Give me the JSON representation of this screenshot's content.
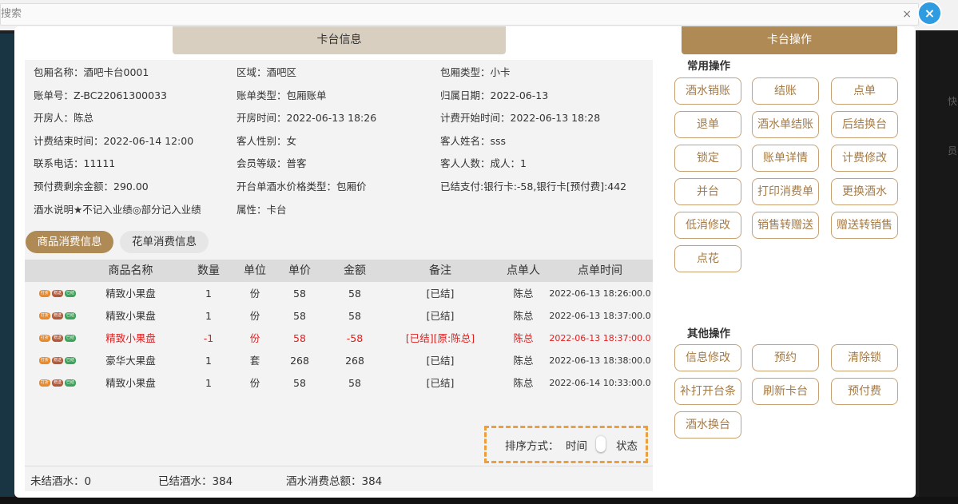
{
  "background": {
    "search_placeholder": "搜索",
    "search_clear": "×",
    "right_text_1": "快",
    "right_text_2": "员"
  },
  "close_label": "×",
  "left_panel": {
    "title": "卡台信息",
    "info": [
      [
        "包厢名称：酒吧卡台0001",
        "区域：酒吧区",
        "包厢类型：小卡"
      ],
      [
        "账单号：Z-BC22061300033",
        "账单类型：包厢账单",
        "归属日期：2022-06-13"
      ],
      [
        "开房人：陈总",
        "开房时间：2022-06-13 18:26",
        "计费开始时间：2022-06-13 18:28"
      ],
      [
        "计费结束时间：2022-06-14 12:00",
        "客人性别：女",
        "客人姓名：sss"
      ],
      [
        "联系电话：11111",
        "会员等级：普客",
        "客人人数：成人：1"
      ],
      [
        "预付费剩余金额：290.00",
        "开台单酒水价格类型：包厢价",
        "已结支付:银行卡:-58,银行卡[预付费]:442"
      ],
      [
        "酒水说明★不记入业绩◎部分记入业绩",
        "属性：卡台",
        ""
      ]
    ],
    "tabs": [
      "商品消费信息",
      "花单消费信息"
    ],
    "table": {
      "headers": [
        "商品名称",
        "数量",
        "单位",
        "单价",
        "金额",
        "备注",
        "点单人",
        "点单时间"
      ],
      "tag_labels": [
        "打折",
        "赠送",
        "已结"
      ],
      "rows": [
        {
          "name": "精致小果盘",
          "qty": "1",
          "unit": "份",
          "price": "58",
          "amount": "58",
          "note": "[已结]",
          "orderer": "陈总",
          "time": "2022-06-13 18:26:00.0",
          "red": false
        },
        {
          "name": "精致小果盘",
          "qty": "1",
          "unit": "份",
          "price": "58",
          "amount": "58",
          "note": "[已结]",
          "orderer": "陈总",
          "time": "2022-06-13 18:37:00.0",
          "red": false
        },
        {
          "name": "精致小果盘",
          "qty": "-1",
          "unit": "份",
          "price": "58",
          "amount": "-58",
          "note": "[已结][原:陈总]",
          "orderer": "陈总",
          "time": "2022-06-13 18:37:00.0",
          "red": true
        },
        {
          "name": "豪华大果盘",
          "qty": "1",
          "unit": "套",
          "price": "268",
          "amount": "268",
          "note": "[已结]",
          "orderer": "陈总",
          "time": "2022-06-13 18:38:00.0",
          "red": false
        },
        {
          "name": "精致小果盘",
          "qty": "1",
          "unit": "份",
          "price": "58",
          "amount": "58",
          "note": "[已结]",
          "orderer": "陈总",
          "time": "2022-06-14 10:33:00.0",
          "red": false
        }
      ]
    },
    "footer": {
      "unsettled": "未结酒水：0",
      "settled": "已结酒水：384",
      "total": "酒水消费总额：384",
      "sort_label": "排序方式：",
      "sort_time": "时间",
      "sort_state": "状态"
    }
  },
  "right_panel": {
    "title": "卡台操作",
    "common_title": "常用操作",
    "common_ops": [
      "酒水销账",
      "结账",
      "点单",
      "退单",
      "酒水单结账",
      "后结换台",
      "锁定",
      "账单详情",
      "计费修改",
      "并台",
      "打印消费单",
      "更换酒水",
      "低消修改",
      "销售转赠送",
      "赠送转销售",
      "点花"
    ],
    "other_title": "其他操作",
    "other_ops": [
      "信息修改",
      "预约",
      "清除锁",
      "补打开台条",
      "刷新卡台",
      "预付费",
      "酒水换台"
    ]
  }
}
